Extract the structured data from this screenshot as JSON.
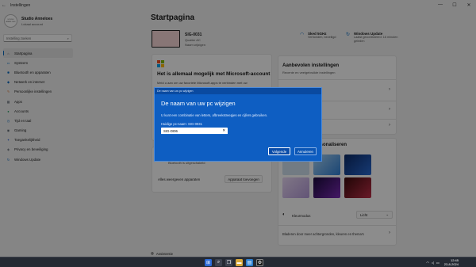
{
  "window": {
    "title": "Instellingen"
  },
  "profile": {
    "avatar_text": "STUDIO ANNELOES",
    "name": "Studio Anneloes",
    "type": "Lokaal account"
  },
  "search": {
    "placeholder": "Instelling zoeken"
  },
  "nav": [
    {
      "label": "Startpagina",
      "icon": "home-icon",
      "color": "#555555"
    },
    {
      "label": "Systeem",
      "icon": "system-icon",
      "color": "#0067c0"
    },
    {
      "label": "Bluetooth en apparaten",
      "icon": "bluetooth-icon",
      "color": "#0067c0"
    },
    {
      "label": "Netwerk en internet",
      "icon": "network-icon",
      "color": "#0067c0"
    },
    {
      "label": "Persoonlijke instellingen",
      "icon": "brush-icon",
      "color": "#e07a3a"
    },
    {
      "label": "Apps",
      "icon": "apps-icon",
      "color": "#5b6470"
    },
    {
      "label": "Accounts",
      "icon": "accounts-icon",
      "color": "#2ea36b"
    },
    {
      "label": "Tijd en taal",
      "icon": "time-icon",
      "color": "#0067c0"
    },
    {
      "label": "Gaming",
      "icon": "gaming-icon",
      "color": "#5b6470"
    },
    {
      "label": "Toegankelijkheid",
      "icon": "accessibility-icon",
      "color": "#3a6fd8"
    },
    {
      "label": "Privacy en beveiliging",
      "icon": "shield-icon",
      "color": "#5b6470"
    },
    {
      "label": "Windows Update",
      "icon": "update-icon",
      "color": "#0067c0"
    }
  ],
  "page": {
    "title": "Startpagina"
  },
  "device": {
    "name": "SIG-0031",
    "model": "Quatter AC",
    "rename": "Naam wijzigen"
  },
  "status": {
    "wifi": {
      "title": "Sked 5GHz",
      "sub": "Verbonden, beveiligd"
    },
    "update": {
      "title": "Windows Update",
      "sub": "Laatst gecontroleerd: 16 minuten geleden"
    }
  },
  "ms_card": {
    "title": "Het is allemaal mogelijk met Microsoft-account",
    "desc": "Meld u aan om uw favoriete Microsoft-apps te verbinden met uw"
  },
  "recommended": {
    "title": "Aanbevolen instellingen",
    "sub": "Recente en veelgebruikte instellingen"
  },
  "personalize": {
    "title": "ersonaliseren"
  },
  "bluetooth": {
    "label": "Bluetooth is uitgeschakeld",
    "toggle": "Uit"
  },
  "devices": {
    "all_label": "Alles weergeven apparaten",
    "add_label": "Apparaat toevoegen"
  },
  "colormode": {
    "label": "Kleurmodus",
    "value": "Licht"
  },
  "browse": {
    "label": "Bladeren door meer achtergronden, kleuren en thema's"
  },
  "assist": {
    "label": "Assistentie"
  },
  "dialog": {
    "topbar": "De naam van uw pc wijzigen",
    "title": "De naam van uw pc wijzigen",
    "sub": "U kunt een combinatie van letters, afbreekstreepjes en cijfers gebruiken.",
    "current": "Huidige pc-naam: SIG-0031",
    "input_value": "SIG-DI06",
    "next": "Volgende",
    "cancel": "Annuleren"
  },
  "taskbar": {
    "time": "12:45",
    "date": "23-8-2024"
  }
}
